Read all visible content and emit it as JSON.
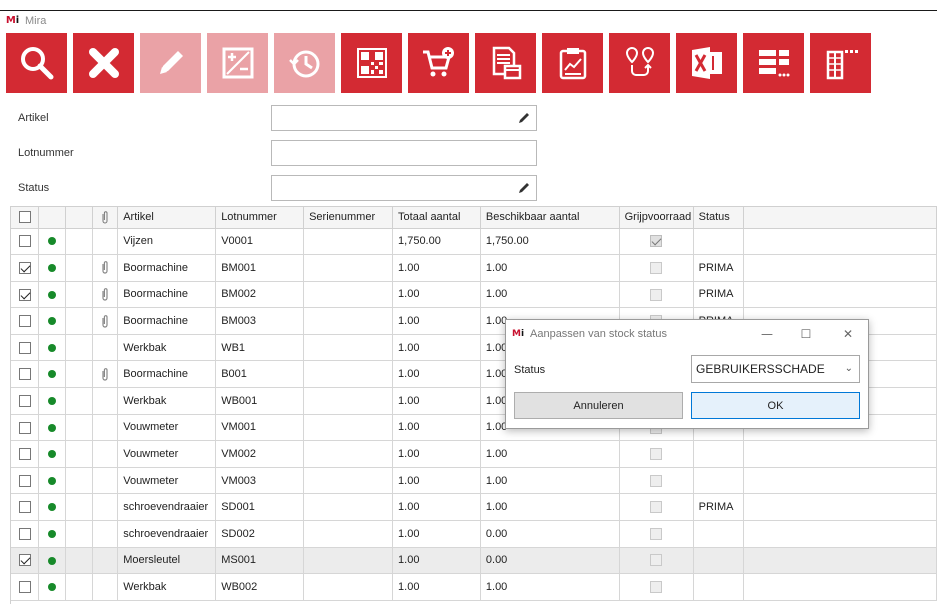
{
  "window": {
    "title": "Mira",
    "logo_text": "Mi",
    "logo_accent": "#c8102e"
  },
  "toolbar": {
    "accent": "#d32a33",
    "accent_disabled": "#eaa2a6",
    "buttons": [
      {
        "icon": "search-icon",
        "enabled": true
      },
      {
        "icon": "delete-icon",
        "enabled": true
      },
      {
        "icon": "edit-icon",
        "enabled": false
      },
      {
        "icon": "calculator-icon",
        "enabled": false
      },
      {
        "icon": "history-icon",
        "enabled": false
      },
      {
        "icon": "qr-code-icon",
        "enabled": true
      },
      {
        "icon": "add-to-cart-icon",
        "enabled": true
      },
      {
        "icon": "document-box-icon",
        "enabled": true
      },
      {
        "icon": "clipboard-chart-icon",
        "enabled": true
      },
      {
        "icon": "route-icon",
        "enabled": true
      },
      {
        "icon": "excel-icon",
        "enabled": true
      },
      {
        "icon": "list-options-icon",
        "enabled": true
      },
      {
        "icon": "column-settings-icon",
        "enabled": true
      }
    ]
  },
  "filters": {
    "artikel_label": "Artikel",
    "artikel_value": "",
    "lotnummer_label": "Lotnummer",
    "lotnummer_value": "",
    "status_label": "Status",
    "status_value": ""
  },
  "grid": {
    "columns": [
      "Artikel",
      "Lotnummer",
      "Serienummer",
      "Totaal aantal",
      "Beschikbaar aantal",
      "Grijpvoorraad",
      "Status"
    ],
    "rows": [
      {
        "checked": false,
        "clip": false,
        "artikel": "Vijzen",
        "lot": "V0001",
        "serie": "",
        "totaal": "1,750.00",
        "beschikbaar": "1,750.00",
        "grijp": true,
        "status": ""
      },
      {
        "checked": true,
        "clip": true,
        "artikel": "Boormachine",
        "lot": "BM001",
        "serie": "",
        "totaal": "1.00",
        "beschikbaar": "1.00",
        "grijp": false,
        "status": "PRIMA"
      },
      {
        "checked": true,
        "clip": true,
        "artikel": "Boormachine",
        "lot": "BM002",
        "serie": "",
        "totaal": "1.00",
        "beschikbaar": "1.00",
        "grijp": false,
        "status": "PRIMA"
      },
      {
        "checked": false,
        "clip": true,
        "artikel": "Boormachine",
        "lot": "BM003",
        "serie": "",
        "totaal": "1.00",
        "beschikbaar": "1.00",
        "grijp": false,
        "status": "PRIMA"
      },
      {
        "checked": false,
        "clip": false,
        "artikel": "Werkbak",
        "lot": "WB1",
        "serie": "",
        "totaal": "1.00",
        "beschikbaar": "1.00",
        "grijp": false,
        "status": ""
      },
      {
        "checked": false,
        "clip": true,
        "artikel": "Boormachine",
        "lot": "B001",
        "serie": "",
        "totaal": "1.00",
        "beschikbaar": "1.00",
        "grijp": false,
        "status": ""
      },
      {
        "checked": false,
        "clip": false,
        "artikel": "Werkbak",
        "lot": "WB001",
        "serie": "",
        "totaal": "1.00",
        "beschikbaar": "1.00",
        "grijp": false,
        "status": ""
      },
      {
        "checked": false,
        "clip": false,
        "artikel": "Vouwmeter",
        "lot": "VM001",
        "serie": "",
        "totaal": "1.00",
        "beschikbaar": "1.00",
        "grijp": false,
        "status": ""
      },
      {
        "checked": false,
        "clip": false,
        "artikel": "Vouwmeter",
        "lot": "VM002",
        "serie": "",
        "totaal": "1.00",
        "beschikbaar": "1.00",
        "grijp": false,
        "status": ""
      },
      {
        "checked": false,
        "clip": false,
        "artikel": "Vouwmeter",
        "lot": "VM003",
        "serie": "",
        "totaal": "1.00",
        "beschikbaar": "1.00",
        "grijp": false,
        "status": ""
      },
      {
        "checked": false,
        "clip": false,
        "artikel": "schroevendraaier",
        "lot": "SD001",
        "serie": "",
        "totaal": "1.00",
        "beschikbaar": "1.00",
        "grijp": false,
        "status": "PRIMA"
      },
      {
        "checked": false,
        "clip": false,
        "artikel": "schroevendraaier",
        "lot": "SD002",
        "serie": "",
        "totaal": "1.00",
        "beschikbaar": "0.00",
        "grijp": false,
        "status": ""
      },
      {
        "checked": true,
        "clip": false,
        "artikel": "Moersleutel",
        "lot": "MS001",
        "serie": "",
        "totaal": "1.00",
        "beschikbaar": "0.00",
        "grijp": false,
        "status": "",
        "selected": true
      },
      {
        "checked": false,
        "clip": false,
        "artikel": "Werkbak",
        "lot": "WB002",
        "serie": "",
        "totaal": "1.00",
        "beschikbaar": "1.00",
        "grijp": false,
        "status": ""
      }
    ]
  },
  "dialog": {
    "title": "Aanpassen van stock status",
    "minimize": "—",
    "maximize": "☐",
    "close": "✕",
    "status_label": "Status",
    "status_value": "GEBRUIKERSSCHADE",
    "cancel_label": "Annuleren",
    "ok_label": "OK"
  }
}
